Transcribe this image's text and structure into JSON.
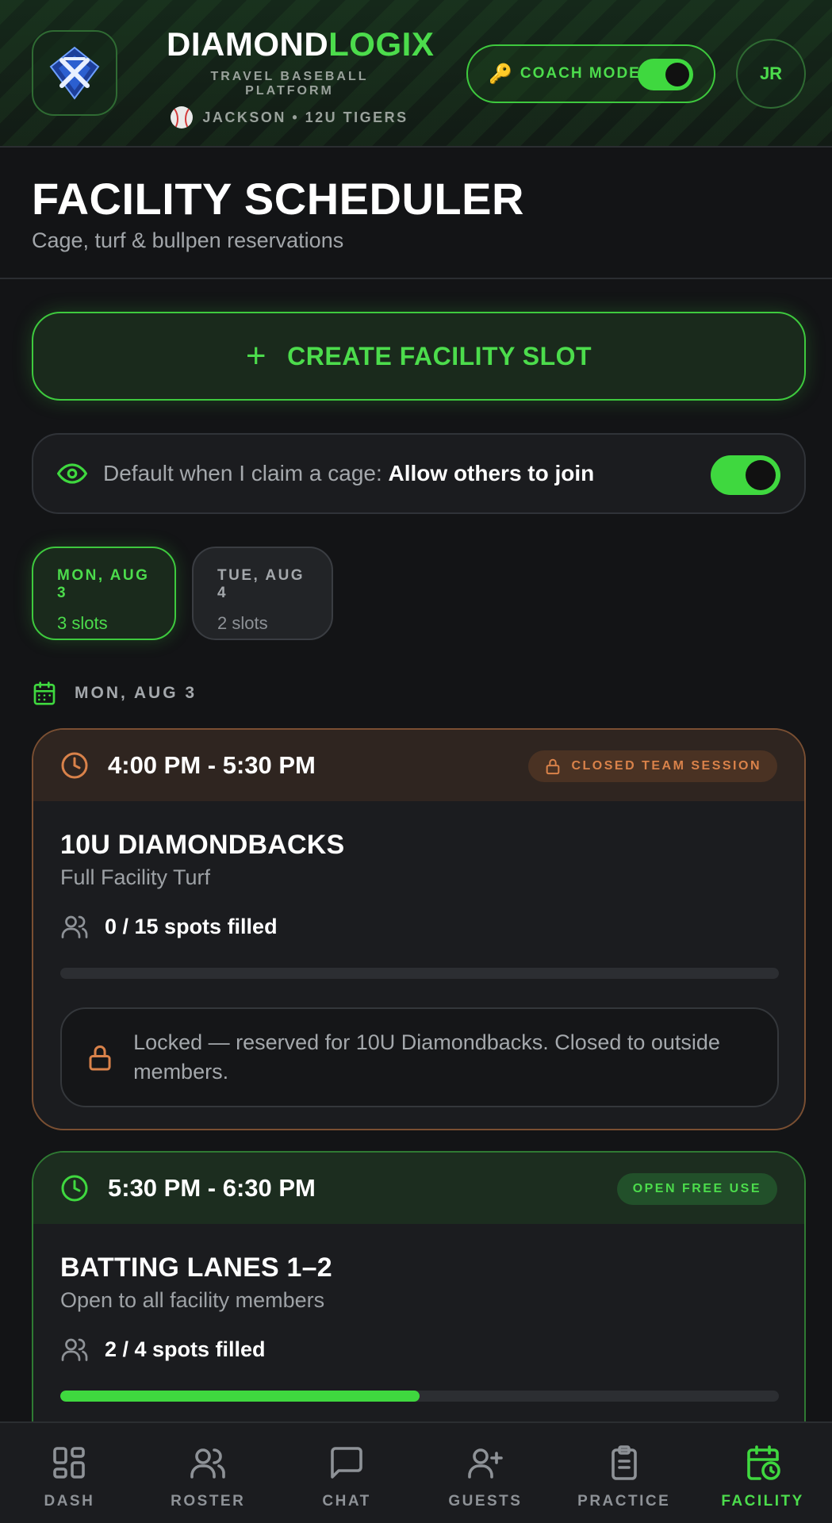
{
  "header": {
    "brand_part1": "DIAMOND",
    "brand_part2": "LOGIX",
    "platform": "TRAVEL BASEBALL PLATFORM",
    "team_line": "JACKSON • 12U TIGERS",
    "coach_mode_label": "COACH MODE",
    "coach_mode_on": true,
    "avatar_initials": "JR"
  },
  "page": {
    "title": "FACILITY SCHEDULER",
    "subtitle": "Cage, turf & bullpen reservations"
  },
  "create_button": {
    "icon": "plus-icon",
    "label": "CREATE FACILITY SLOT"
  },
  "default_pref": {
    "icon": "eye-icon",
    "prefix": "Default when I claim a cage: ",
    "value": "Allow others to join",
    "enabled": true
  },
  "days": [
    {
      "day": "MON, AUG 3",
      "slots": "3 slots",
      "selected": true
    },
    {
      "day": "TUE, AUG 4",
      "slots": "2 slots",
      "selected": false
    }
  ],
  "section_date": "MON, AUG 3",
  "slots": [
    {
      "time": "4:00 PM - 5:30 PM",
      "badge": "CLOSED TEAM SESSION",
      "name": "10U DIAMONDBACKS",
      "location": "Full Facility Turf",
      "spots": "0 / 15 spots filled",
      "fill_fraction": 0,
      "locked_message": "Locked — reserved for 10U Diamondbacks. Closed to outside members."
    },
    {
      "time": "5:30 PM - 6:30 PM",
      "badge": "OPEN FREE USE",
      "name": "BATTING LANES 1–2",
      "location": "Open to all facility members",
      "spots": "2 / 4 spots filled",
      "fill_fraction": 0.5
    }
  ],
  "nav": [
    {
      "label": "DASH",
      "icon": "dashboard-icon",
      "active": false
    },
    {
      "label": "ROSTER",
      "icon": "users-icon",
      "active": false
    },
    {
      "label": "CHAT",
      "icon": "chat-icon",
      "active": false
    },
    {
      "label": "GUESTS",
      "icon": "user-plus-icon",
      "active": false
    },
    {
      "label": "PRACTICE",
      "icon": "clipboard-icon",
      "active": false
    },
    {
      "label": "FACILITY",
      "icon": "calendar-clock-icon",
      "active": true
    }
  ],
  "colors": {
    "accent": "#3fd83f",
    "closed": "#d9824a",
    "background": "#131416"
  }
}
